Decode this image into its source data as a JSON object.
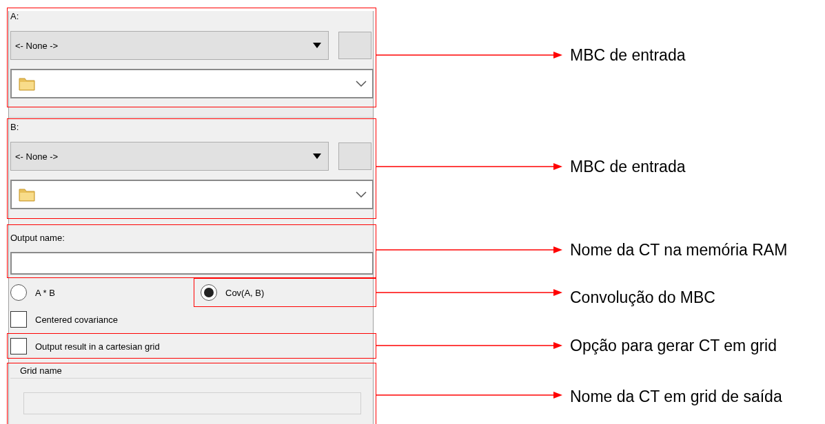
{
  "inputs": [
    {
      "label": "A:",
      "selection": "<- None ->"
    },
    {
      "label": "B:",
      "selection": "<- None ->"
    }
  ],
  "output_name": {
    "label": "Output name:"
  },
  "operations": [
    {
      "label": "A * B",
      "selected": false
    },
    {
      "label": "Cov(A, B)",
      "selected": true
    }
  ],
  "options": [
    {
      "label": "Centered covariance",
      "checked": false
    },
    {
      "label": "Output result in a cartesian grid",
      "checked": false
    }
  ],
  "grid_name": {
    "title": "Grid name",
    "disabled": true
  },
  "annotations": [
    "MBC de entrada",
    "MBC de entrada",
    "Nome da CT na memória RAM",
    "Convolução do MBC",
    "Opção para gerar CT em grid",
    "Nome da CT em grid de saída"
  ]
}
